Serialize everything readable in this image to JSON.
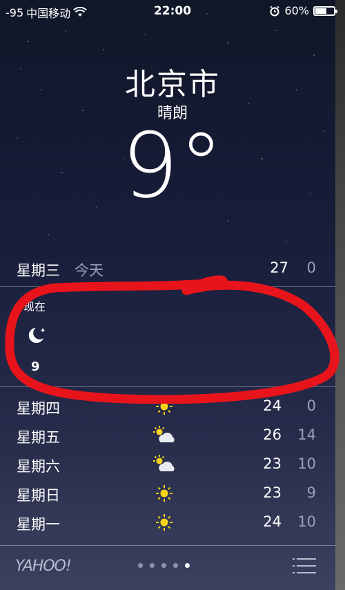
{
  "status_bar": {
    "signal": "-95",
    "carrier": "中国移动",
    "time": "22:00",
    "battery": "60%",
    "battery_level": 0.6
  },
  "location": {
    "city": "北京市",
    "condition": "晴朗",
    "temperature": "9°"
  },
  "today": {
    "day": "星期三",
    "label": "今天",
    "high": "27",
    "low": "0"
  },
  "hourly": [
    {
      "time": "现在",
      "icon": "moon-star-icon",
      "temp": "9"
    }
  ],
  "daily": [
    {
      "day": "星期四",
      "icon": "sun-icon",
      "high": "24",
      "low": "0"
    },
    {
      "day": "星期五",
      "icon": "partly-cloudy-icon",
      "high": "26",
      "low": "14"
    },
    {
      "day": "星期六",
      "icon": "partly-cloudy-icon",
      "high": "23",
      "low": "10"
    },
    {
      "day": "星期日",
      "icon": "sun-icon",
      "high": "23",
      "low": "9"
    },
    {
      "day": "星期一",
      "icon": "sun-icon",
      "high": "24",
      "low": "10"
    }
  ],
  "footer": {
    "logo_text": "YAHOO!",
    "page_count": 5,
    "active_page": 5
  },
  "colors": {
    "annotation": "#e8141c",
    "sun": "#f7d21a",
    "secondary_text": "#9aa0b8"
  }
}
